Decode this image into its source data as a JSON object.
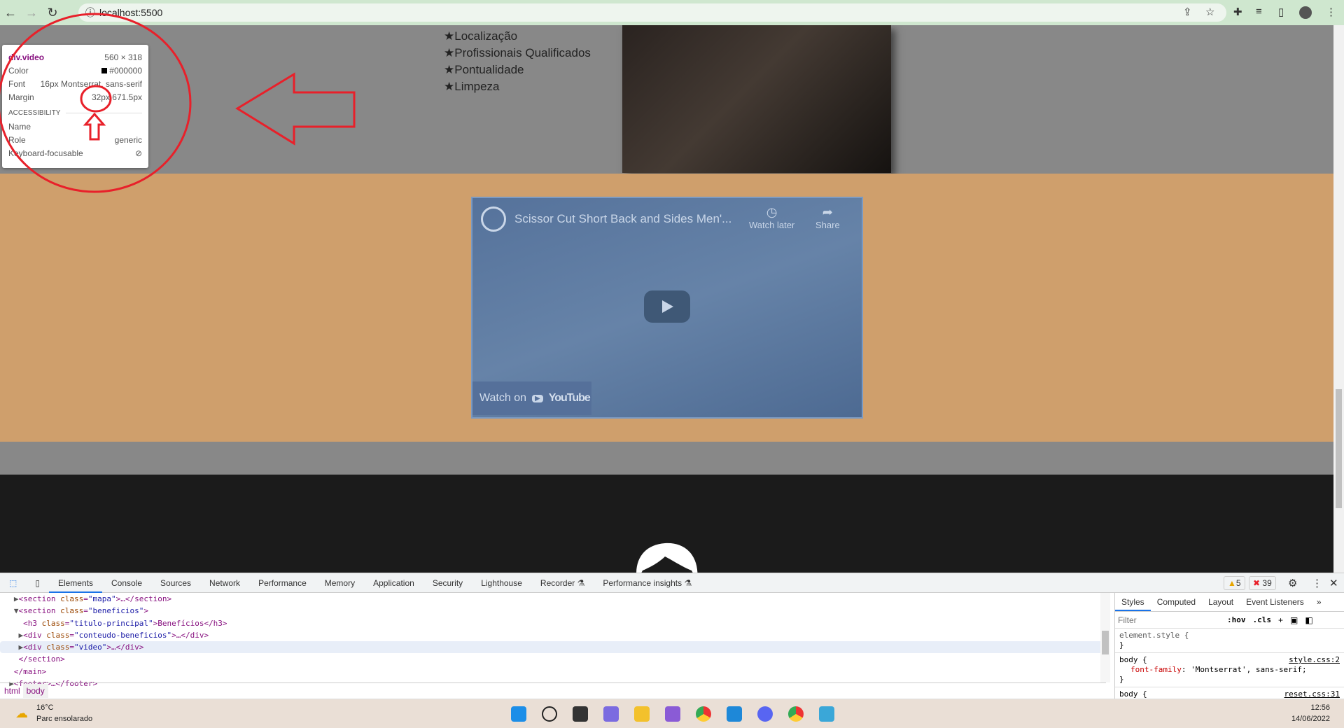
{
  "browser": {
    "url": "localhost:5500",
    "icons": [
      "back-icon",
      "forward-icon",
      "reload-icon",
      "info-icon",
      "share-icon",
      "star-icon",
      "extensions-icon",
      "media-icon",
      "sidepanel-icon",
      "profile-avatar",
      "menu-icon"
    ]
  },
  "page": {
    "benefits_list": [
      "Localização",
      "Profissionais Qualificados",
      "Pontualidade",
      "Limpeza"
    ],
    "video": {
      "title": "Scissor Cut Short Back and Sides Men'...",
      "watch_later": "Watch later",
      "share": "Share",
      "watch_on": "Watch on",
      "youtube": "YouTube"
    },
    "colors": {
      "gray": "#888888",
      "beige": "#cf9f6c",
      "footer": "#1b1b1b"
    }
  },
  "tooltip": {
    "element": "div.video",
    "size": "560 × 318",
    "color_label": "Color",
    "color_value": "#000000",
    "font_label": "Font",
    "font_value": "16px Montserrat, sans-serif",
    "margin_label": "Margin",
    "margin_value": "32px 671.5px",
    "accessibility": "ACCESSIBILITY",
    "name_label": "Name",
    "role_label": "Role",
    "role_value": "generic",
    "focus_label": "Keyboard-focusable"
  },
  "annotation": {
    "color": "#e8202a"
  },
  "devtools": {
    "tabs": [
      "Elements",
      "Console",
      "Sources",
      "Network",
      "Performance",
      "Memory",
      "Application",
      "Security",
      "Lighthouse",
      "Recorder",
      "Performance insights"
    ],
    "warnings": "5",
    "errors": "39",
    "dom": [
      {
        "indent": "   ",
        "arrow": "▶",
        "tag": "section",
        "cls": "mapa",
        "tail": ">…</section>"
      },
      {
        "indent": "   ",
        "arrow": "▼",
        "tag": "section",
        "cls": "beneficios",
        "tail": ">"
      },
      {
        "indent": "     ",
        "arrow": "",
        "tag": "h3",
        "cls": "titulo-principal",
        "tail": ">Benefícios</h3>"
      },
      {
        "indent": "    ",
        "arrow": "▶",
        "tag": "div",
        "cls": "conteudo-beneficios",
        "tail": ">…</div>"
      },
      {
        "indent": "    ",
        "arrow": "▶",
        "tag": "div",
        "cls": "video",
        "tail": ">…</div>"
      },
      {
        "indent": "    ",
        "arrow": "",
        "text": "</section>"
      },
      {
        "indent": "   ",
        "arrow": "",
        "text": "</main>"
      },
      {
        "indent": "  ",
        "arrow": "▶",
        "text": "<footer>…</footer>"
      }
    ],
    "breadcrumbs": [
      "html",
      "body"
    ],
    "styles_tabs": [
      "Styles",
      "Computed",
      "Layout",
      "Event Listeners",
      "»"
    ],
    "filter_placeholder": "Filter",
    "hov": ":hov",
    "cls": ".cls",
    "rules": {
      "element_style": "element.style {",
      "close": "}",
      "body_sel": "body {",
      "body_src": "style.css:2",
      "prop": "font-family",
      "val": "'Montserrat', sans-serif;",
      "next_sel": "body {",
      "next_src": "reset.css:31"
    }
  },
  "taskbar": {
    "temp": "16°C",
    "weather": "Parc ensolarado",
    "time": "12:56",
    "date": "14/06/2022"
  }
}
